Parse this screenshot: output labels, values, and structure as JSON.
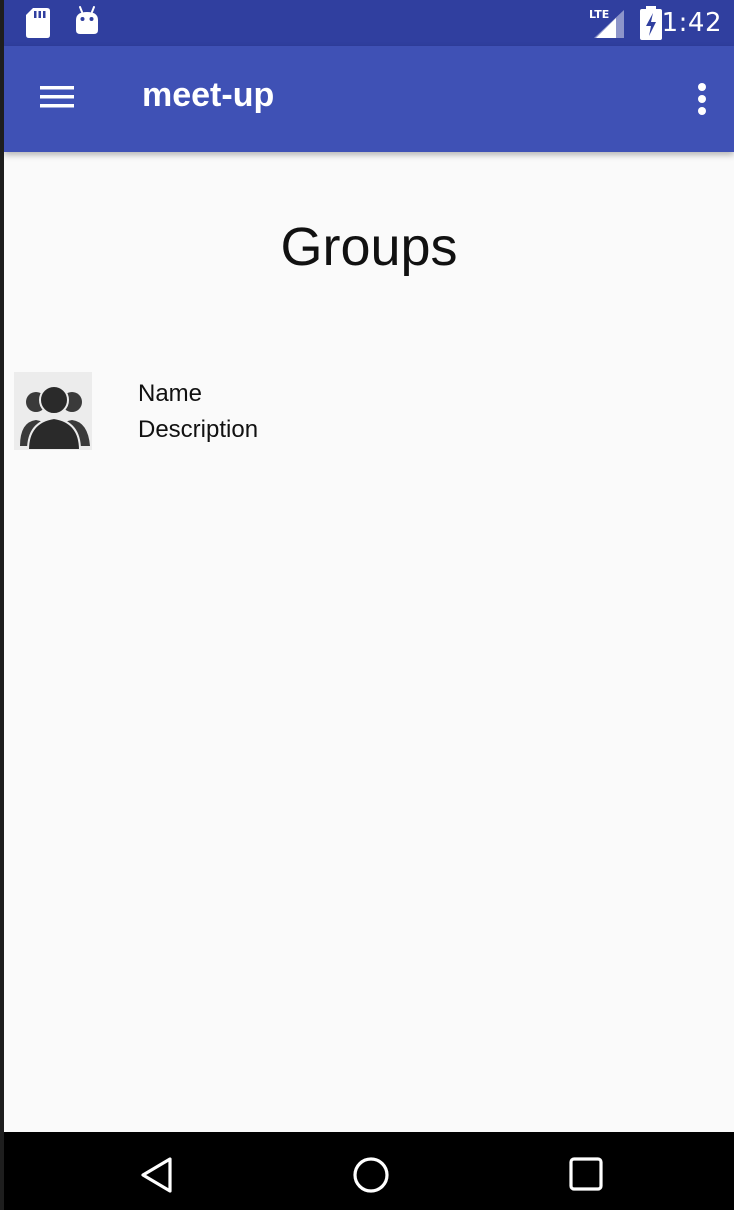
{
  "status_bar": {
    "time": "1:42",
    "network": "LTE",
    "icons": [
      "sd-card-icon",
      "android-icon",
      "signal-icon",
      "battery-charging-icon"
    ]
  },
  "app_bar": {
    "title": "meet-up",
    "menu_icon": "menu-icon",
    "overflow_icon": "more-vert-icon",
    "color": "#3f51b5",
    "status_color": "#303f9f"
  },
  "main": {
    "heading": "Groups",
    "groups": [
      {
        "name": "Name",
        "description": "Description",
        "icon": "group-icon"
      }
    ]
  },
  "nav_bar": {
    "icons": [
      "back-icon",
      "home-icon",
      "recents-icon"
    ]
  }
}
